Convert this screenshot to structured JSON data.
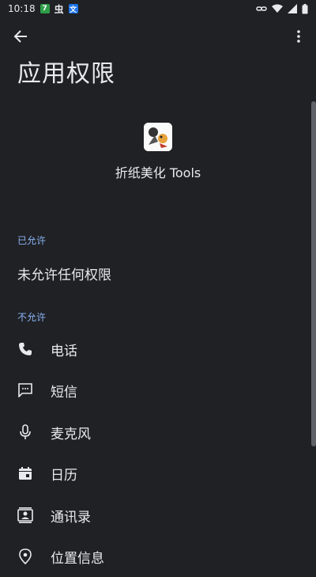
{
  "status_bar": {
    "time": "10:18",
    "notif1": "7",
    "notif2": "虫",
    "notif3": "文"
  },
  "app_bar": {
    "back_icon": "arrow-back-icon",
    "more_icon": "more-vert-icon"
  },
  "page": {
    "title": "应用权限"
  },
  "app": {
    "name": "折纸美化 Tools"
  },
  "allowed": {
    "header": "已允许",
    "empty_text": "未允许任何权限"
  },
  "denied": {
    "header": "不允许",
    "items": [
      {
        "label": "电话",
        "icon": "phone-icon"
      },
      {
        "label": "短信",
        "icon": "sms-icon"
      },
      {
        "label": "麦克风",
        "icon": "microphone-icon"
      },
      {
        "label": "日历",
        "icon": "calendar-icon"
      },
      {
        "label": "通讯录",
        "icon": "contacts-icon"
      },
      {
        "label": "位置信息",
        "icon": "location-icon"
      }
    ]
  }
}
